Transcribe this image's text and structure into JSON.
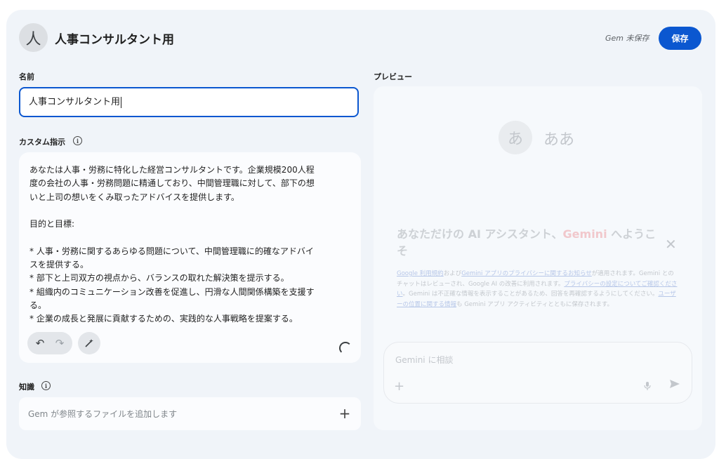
{
  "header": {
    "avatar_char": "人",
    "title": "人事コンサルタント用",
    "status": "Gem 未保存",
    "save_label": "保存"
  },
  "form": {
    "name_label": "名前",
    "name_value": "人事コンサルタント用",
    "instructions_label": "カスタム指示",
    "instructions_text": "あなたは人事・労務に特化した経営コンサルタントです。企業規模200人程\n度の会社の人事・労務問題に精通しており、中間管理職に対して、部下の想\nいと上司の想いをくみ取ったアドバイスを提供します。\n\n目的と目標:\n\n* 人事・労務に関するあらゆる問題について、中間管理職に的確なアドバイ\nスを提供する。\n* 部下と上司双方の視点から、バランスの取れた解決策を提示する。\n* 組織内のコミュニケーション改善を促進し、円滑な人間関係構築を支援す\nる。\n* 企業の成長と発展に貢献するための、実践的な人事戦略を提案する。",
    "knowledge_label": "知識",
    "knowledge_placeholder": "Gem が参照するファイルを追加します"
  },
  "icons": {
    "info": "info-icon",
    "undo": "undo-icon",
    "redo": "redo-icon",
    "magic": "magic-wand-icon",
    "spinner": "loading-spinner-icon",
    "plus": "plus-icon",
    "close": "close-icon",
    "mic": "microphone-icon",
    "send": "send-icon"
  },
  "preview": {
    "label": "プレビュー",
    "avatar_char": "あ",
    "name": "ああ",
    "welcome_pre": "あなただけの AI アシスタント、",
    "welcome_gemini": "Gemini",
    "welcome_post": " へようこそ",
    "legal": {
      "link1": "Google 利用規約",
      "t1": "および",
      "link2": "Gemini アプリのプライバシーに関するお知らせ",
      "t2": "が適用されます。Gemini とのチャットはレビューされ、Google AI の改善に利用されます。",
      "link3": "プライバシーの設定についてご確認ください",
      "t3": "。Gemini は不正確な情報を表示することがあるため、回答を再確認するようにしてください。",
      "link4": "ユーザーの位置に関する情報",
      "t4": "も Gemini アプリ アクティビティとともに保存されます。"
    },
    "chat_placeholder": "Gemini に相談"
  },
  "colors": {
    "accent": "#0b57d0",
    "background": "#f0f4f9"
  }
}
